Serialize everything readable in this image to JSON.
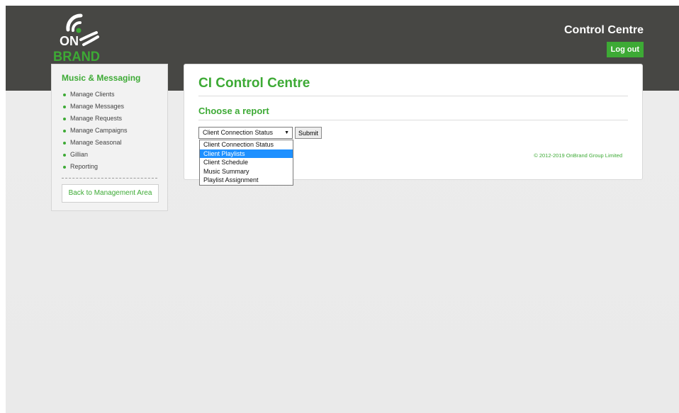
{
  "header": {
    "logo_text_top": "ON",
    "logo_text_bottom": "BRAND",
    "title": "Control Centre",
    "logout_label": "Log out"
  },
  "colors": {
    "brand_green": "#3daa35",
    "topbar": "#474744",
    "selected_option": "#1e90ff"
  },
  "sidebar": {
    "title": "Music & Messaging",
    "items": [
      {
        "label": "Manage Clients"
      },
      {
        "label": "Manage Messages"
      },
      {
        "label": "Manage Requests"
      },
      {
        "label": "Manage Campaigns"
      },
      {
        "label": "Manage Seasonal"
      },
      {
        "label": "Gillian"
      },
      {
        "label": "Reporting"
      }
    ],
    "back_label": "Back to Management Area"
  },
  "main": {
    "title": "CI Control Centre",
    "subtitle": "Choose a report",
    "select_value": "Client Connection Status",
    "submit_label": "Submit",
    "copyright": "© 2012-2019 OnBrand Group Limited"
  },
  "dropdown": {
    "options": [
      {
        "label": "Client Connection Status"
      },
      {
        "label": "Client Playlists"
      },
      {
        "label": "Client Schedule"
      },
      {
        "label": "Music Summary"
      },
      {
        "label": "Playlist Assignment"
      }
    ],
    "highlighted_option": "Client Playlists"
  }
}
